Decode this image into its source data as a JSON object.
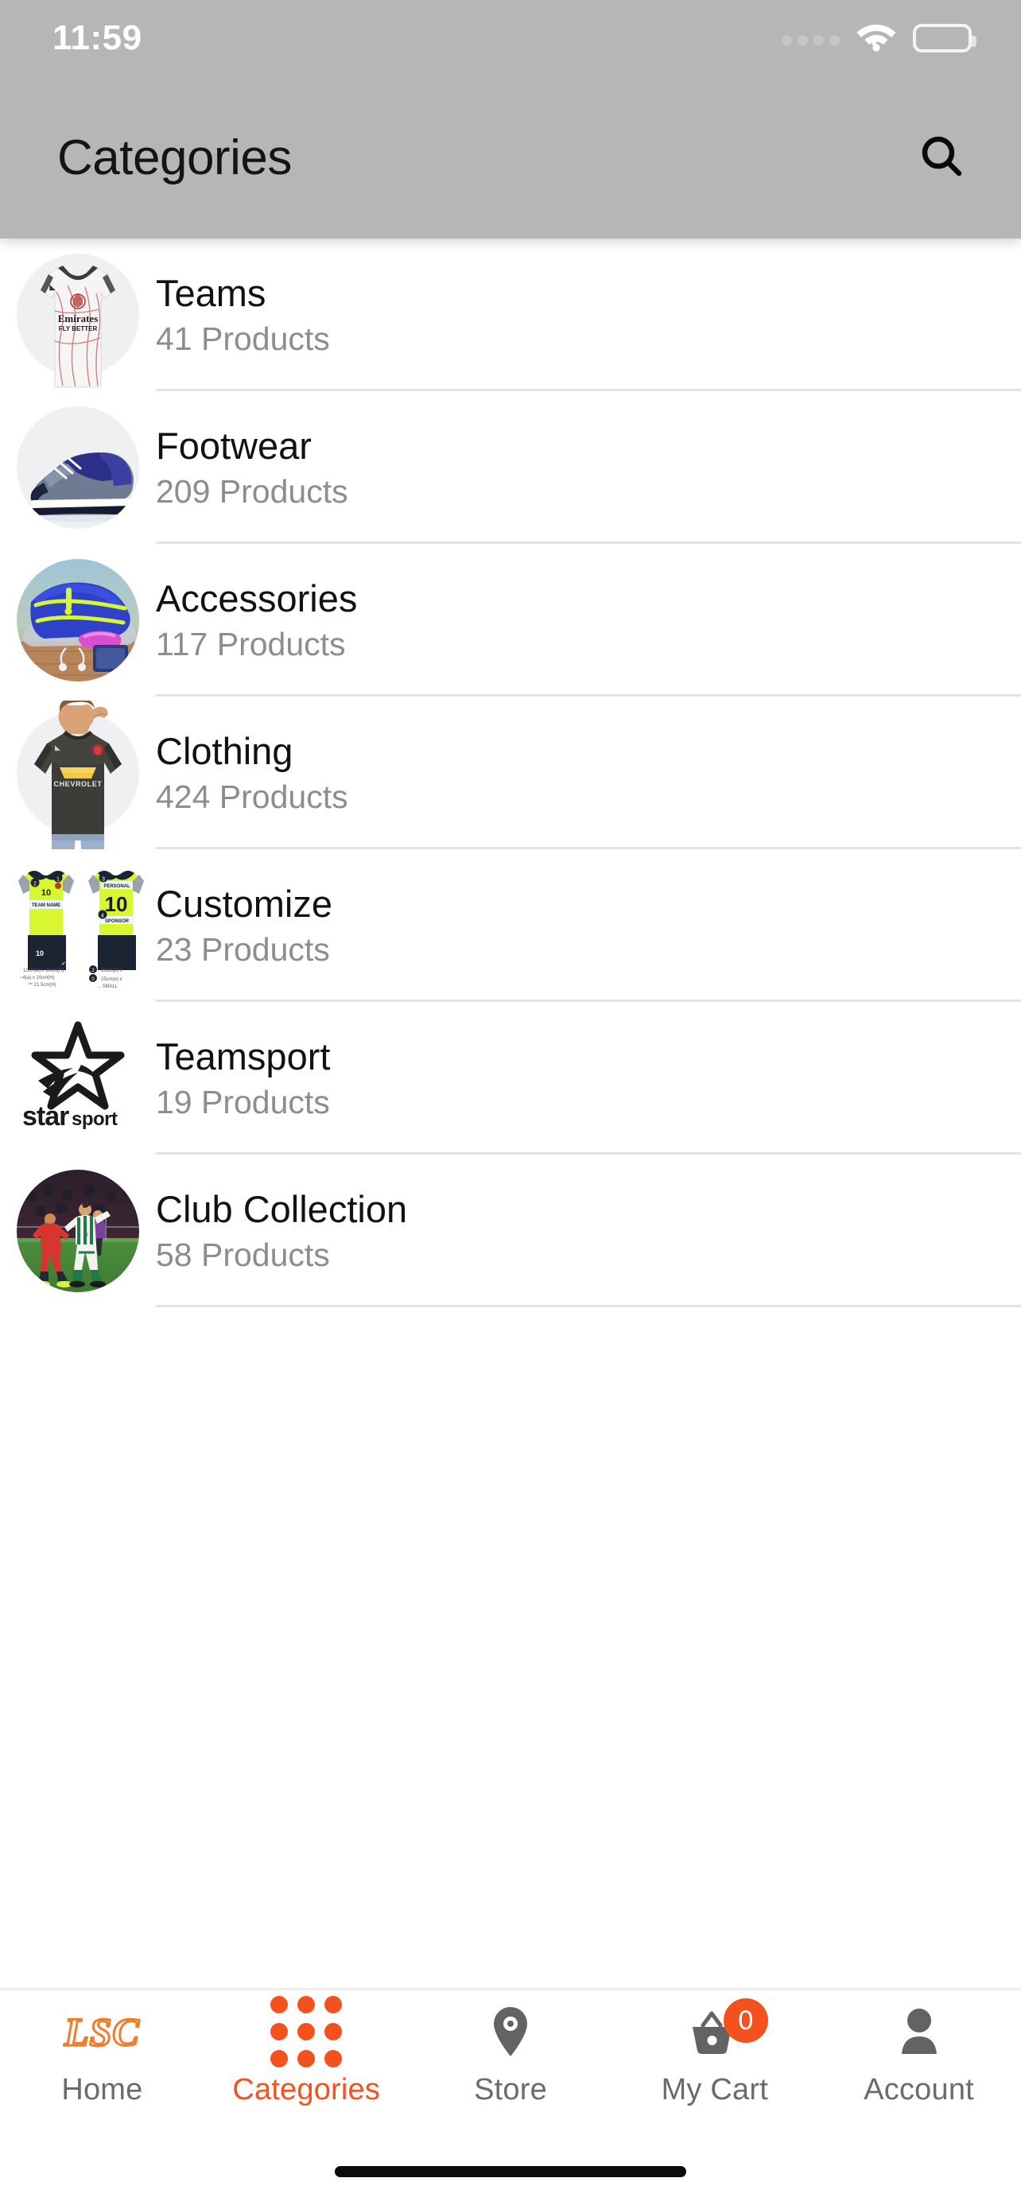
{
  "status_bar": {
    "time": "11:59",
    "signal_icon": "signal-dots-icon",
    "wifi_icon": "wifi-icon",
    "battery_icon": "battery-icon"
  },
  "header": {
    "title": "Categories",
    "search_icon": "search-icon",
    "background_color": "#b6b6b6"
  },
  "categories": [
    {
      "title": "Teams",
      "products": "41 Products",
      "thumb": "arsenal-white-jersey"
    },
    {
      "title": "Footwear",
      "products": "209 Products",
      "thumb": "navy-running-shoe"
    },
    {
      "title": "Accessories",
      "products": "117 Products",
      "thumb": "blue-waist-bag"
    },
    {
      "title": "Clothing",
      "products": "424 Products",
      "thumb": "chevrolet-dark-jersey"
    },
    {
      "title": "Customize",
      "products": "23 Products",
      "thumb": "neon-custom-kits"
    },
    {
      "title": "Teamsport",
      "products": "19 Products",
      "thumb": "starsport-logo"
    },
    {
      "title": "Club Collection",
      "products": "58 Products",
      "thumb": "soccer-match-photo"
    }
  ],
  "tab_bar": {
    "active_color": "#f4511e",
    "inactive_color": "#6b6b6b",
    "items": [
      {
        "label": "Home",
        "icon": "lsc-logo-icon",
        "text": "LSC",
        "active": false
      },
      {
        "label": "Categories",
        "icon": "grid-dots-icon",
        "active": true
      },
      {
        "label": "Store",
        "icon": "location-pin-icon",
        "active": false
      },
      {
        "label": "My Cart",
        "icon": "shopping-basket-icon",
        "badge": "0",
        "active": false
      },
      {
        "label": "Account",
        "icon": "person-icon",
        "active": false
      }
    ]
  }
}
